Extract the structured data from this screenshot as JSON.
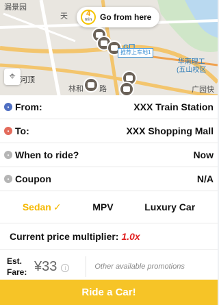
{
  "map": {
    "labels": [
      "漏景园",
      "天",
      "沙河顶",
      "林和",
      "路",
      "华南理工",
      "(五山校区",
      "广园快",
      "G口",
      "推荐上车地1"
    ],
    "tooltip": {
      "eta_value": "4",
      "eta_unit": "min",
      "text": "Go from here"
    },
    "pickup_label": "推荐上车地1"
  },
  "trip": {
    "from_label": "From:",
    "from_value": "XXX Train Station",
    "to_label": "To:",
    "to_value": "XXX Shopping Mall",
    "when_label": "When to ride?",
    "when_value": "Now",
    "coupon_label": "Coupon",
    "coupon_value": "N/A"
  },
  "car_types": [
    {
      "label": "Sedan",
      "selected": true,
      "check": "✓"
    },
    {
      "label": "MPV",
      "selected": false
    },
    {
      "label": "Luxury Car",
      "selected": false
    }
  ],
  "pricing": {
    "multiplier_label": "Current price multiplier:",
    "multiplier_value": "1.0x",
    "est_label_1": "Est.",
    "est_label_2": "Fare:",
    "amount": "¥33",
    "info_icon": "i",
    "promotions": "Other available promotions"
  },
  "cta": {
    "label": "Ride a Car!"
  },
  "colors": {
    "accent": "#f6c427",
    "multiplier": "#e01f1f"
  }
}
